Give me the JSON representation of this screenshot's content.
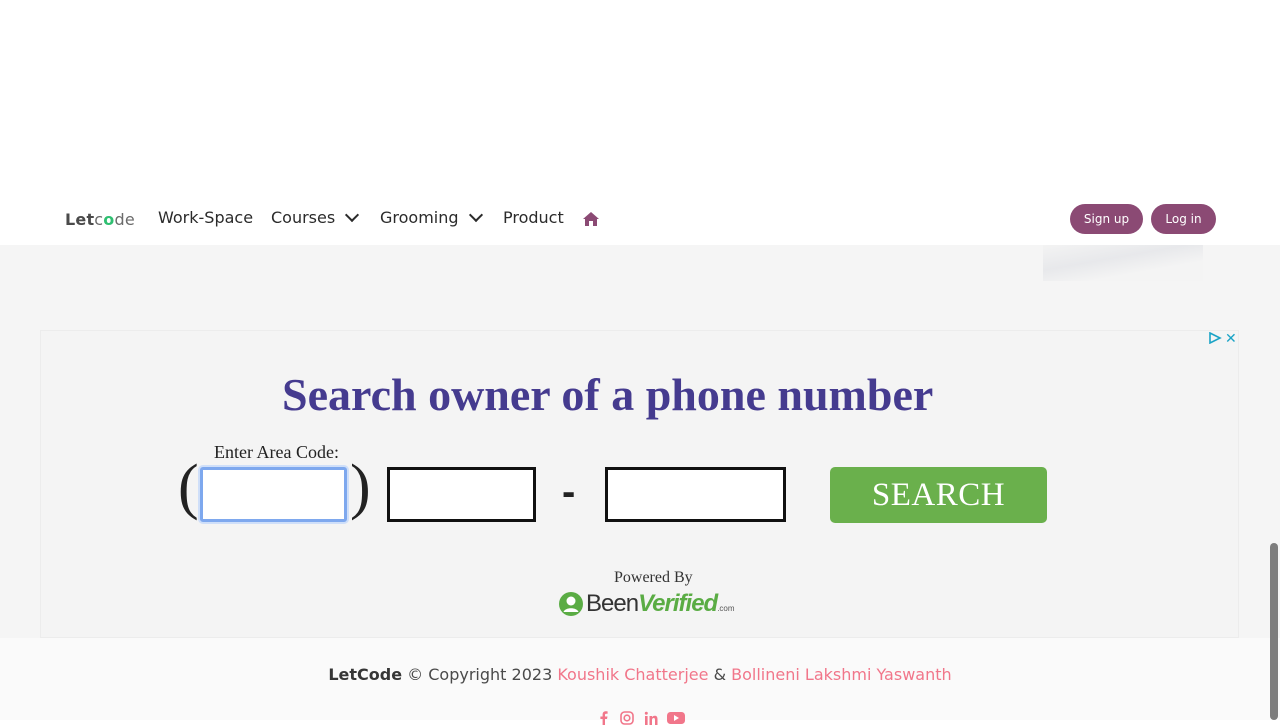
{
  "brand": {
    "let": "Let",
    "c": "c",
    "o": "o",
    "de": "de"
  },
  "nav": {
    "items": [
      "Work-Space",
      "Courses",
      "Grooming",
      "Product"
    ],
    "home_icon": "home-icon",
    "signup": "Sign up",
    "login": "Log in",
    "accent_color": "#8b4a74"
  },
  "ad": {
    "title": "Search owner of a phone number",
    "area_label": "Enter Area Code:",
    "open_paren": "(",
    "close_paren": ")",
    "dash": "-",
    "search_button": "SEARCH",
    "powered_by": "Powered By",
    "logo_been": "Been",
    "logo_verified": "Verified",
    "logo_com": ".com",
    "title_color": "#453b8f",
    "button_color": "#6ab04c"
  },
  "footer": {
    "brand": "LetCode",
    "copyright": "© Copyright 2023",
    "author1": "Koushik Chatterjee",
    "amp": "&",
    "author2": "Bollineni Lakshmi Yaswanth",
    "link_color": "#f1768a"
  }
}
